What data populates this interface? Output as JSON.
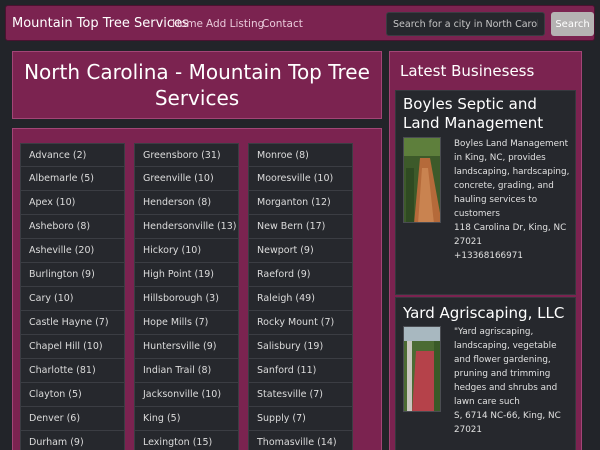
{
  "navbar": {
    "brand": "Mountain Top Tree Services",
    "links": [
      "Home",
      "Add Listing",
      "Contact"
    ],
    "search_placeholder": "Search for a city in North Carolina",
    "search_button": "Search"
  },
  "page_title": "North Carolina - Mountain Top Tree Services",
  "cities": {
    "col1": [
      "Advance (2)",
      "Albemarle (5)",
      "Apex (10)",
      "Asheboro (8)",
      "Asheville (20)",
      "Burlington (9)",
      "Cary (10)",
      "Castle Hayne (7)",
      "Chapel Hill (10)",
      "Charlotte (81)",
      "Clayton (5)",
      "Denver (6)",
      "Durham (9)"
    ],
    "col2": [
      "Greensboro (31)",
      "Greenville (10)",
      "Henderson (8)",
      "Hendersonville (13)",
      "Hickory (10)",
      "High Point (19)",
      "Hillsborough (3)",
      "Hope Mills (7)",
      "Huntersville (9)",
      "Indian Trail (8)",
      "Jacksonville (10)",
      "King (5)",
      "Lexington (15)"
    ],
    "col3": [
      "Monroe (8)",
      "Mooresville (10)",
      "Morganton (12)",
      "New Bern (17)",
      "Newport (9)",
      "Raeford (9)",
      "Raleigh (49)",
      "Rocky Mount (7)",
      "Salisbury (19)",
      "Sanford (11)",
      "Statesville (7)",
      "Supply (7)",
      "Thomasville (14)"
    ]
  },
  "sidebar": {
    "title": "Latest Businesess",
    "businesses": [
      {
        "name": "Boyles Septic and Land Management",
        "description": "Boyles Land Management in King, NC, provides landscaping, hardscaping, concrete, grading, and hauling services to customers",
        "address": "118 Carolina Dr, King, NC 27021",
        "phone": "+13368166971"
      },
      {
        "name": "Yard Agriscaping, LLC",
        "description": "\"Yard agriscaping, landscaping, vegetable and flower gardening, pruning and trimming hedges and shrubs and lawn care such",
        "address": "S, 6714 NC-66, King, NC 27021"
      }
    ]
  }
}
